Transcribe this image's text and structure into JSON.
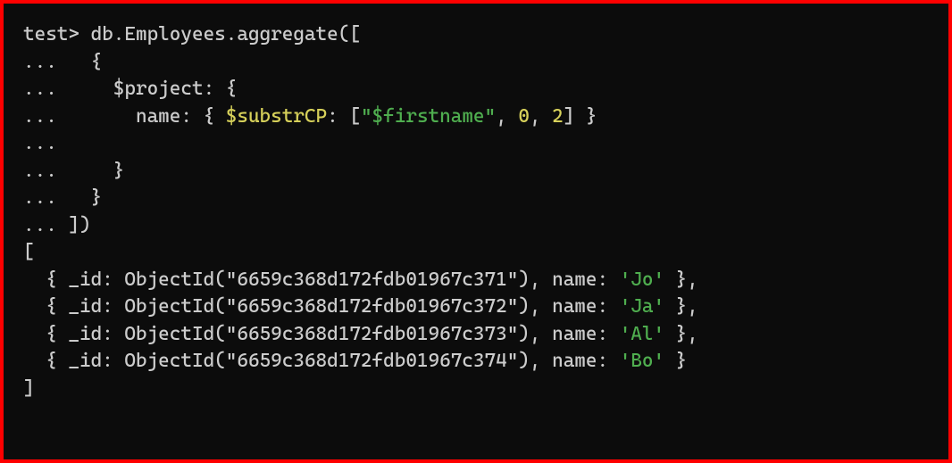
{
  "prompt_db": "test>",
  "cont": "...",
  "cmd": {
    "l1": " db.Employees.aggregate([",
    "l2": "   {",
    "l3": "     $project: {",
    "l4a": "       name: { ",
    "op": "$substrCP",
    "l4b": ": [",
    "arg_str": "\"$firstname\"",
    "sep1": ", ",
    "arg_n1": "0",
    "sep2": ", ",
    "arg_n2": "2",
    "l4c": "] }",
    "l5": "",
    "l6": "     }",
    "l7": "   }",
    "l8": " ])"
  },
  "out": {
    "open": "[",
    "rows": [
      {
        "pre": "  { _id: ObjectId(\"6659c368d172fdb01967c371\"), name: ",
        "val": "'Jo'",
        "post": " },"
      },
      {
        "pre": "  { _id: ObjectId(\"6659c368d172fdb01967c372\"), name: ",
        "val": "'Ja'",
        "post": " },"
      },
      {
        "pre": "  { _id: ObjectId(\"6659c368d172fdb01967c373\"), name: ",
        "val": "'Al'",
        "post": " },"
      },
      {
        "pre": "  { _id: ObjectId(\"6659c368d172fdb01967c374\"), name: ",
        "val": "'Bo'",
        "post": " }"
      }
    ],
    "close": "]"
  }
}
